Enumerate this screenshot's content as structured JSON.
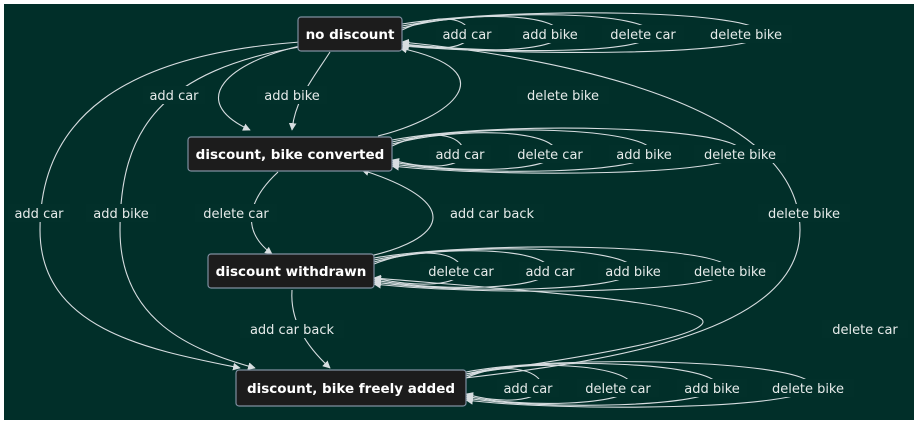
{
  "colors": {
    "background": "#012f29",
    "node_fill": "#1c1c1c",
    "node_border": "#7f8fa0",
    "edge": "#d7dde0",
    "text": "#ffffff"
  },
  "nodes": {
    "no_discount": "no discount",
    "bike_converted": "discount, bike converted",
    "withdrawn": "discount withdrawn",
    "freely_added": "discount, bike freely added"
  },
  "labels": {
    "nd_self": [
      "add car",
      "add bike",
      "delete car",
      "delete bike"
    ],
    "bc_self": [
      "add car",
      "delete car",
      "add bike",
      "delete bike"
    ],
    "wd_self": [
      "delete car",
      "add car",
      "add bike",
      "delete bike"
    ],
    "fa_self": [
      "add car",
      "delete car",
      "add bike",
      "delete bike"
    ],
    "nd_to_bc_car": "add car",
    "nd_to_bc_bike": "add bike",
    "bc_to_nd": "delete bike",
    "nd_to_fa_car": "add car",
    "nd_to_fa_bike": "add bike",
    "fa_to_nd": "delete bike",
    "bc_to_wd": "delete car",
    "wd_to_bc": "add car back",
    "wd_to_fa": "add car back",
    "fa_to_wd": "delete car"
  }
}
